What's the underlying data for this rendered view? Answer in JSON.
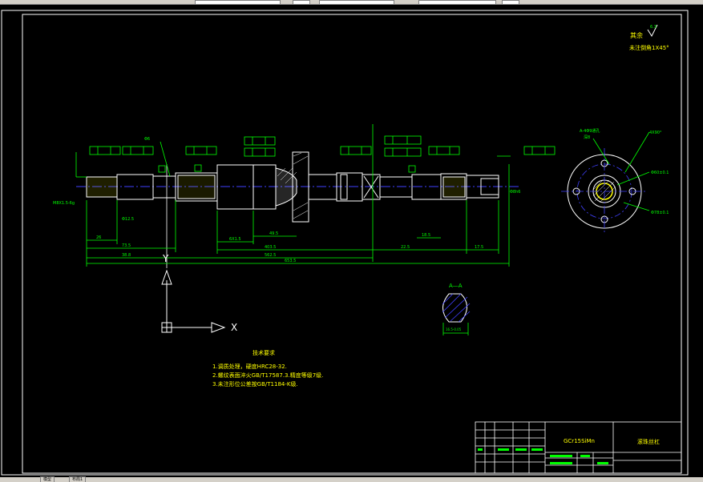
{
  "annotations": {
    "roughness_label": "其余",
    "chamfer_note": "未注倒角1X45°",
    "roughness_value": "6.3"
  },
  "dims": {
    "d_left_end": "Φ12.5",
    "d_tail": "Φ6",
    "d_right_bore": "Φ8h6",
    "bottom_1": "26",
    "bottom_2": "73.5",
    "bottom_3": "6X1.5",
    "bottom_4": "49.5",
    "bottom_5": "403.5",
    "bottom_6": "22.5",
    "bottom_7": "18.5",
    "bottom_8": "17.5",
    "overall_1": "38.8",
    "overall_2": "562.5",
    "overall_total": "653.5",
    "left_end_note": "M8X1.5-6g",
    "section_width": "16.5-0.05"
  },
  "section_a": {
    "title": "A—A"
  },
  "flange_view": {
    "label1": "A-4Φ9通孔",
    "label2": "深8",
    "label3": "4X90°",
    "label4": "Φ60±0.1",
    "label5": "Φ78±0.1"
  },
  "ucs": {
    "x": "X",
    "y": "Y"
  },
  "tech_req": {
    "title": "技术要求",
    "lines": [
      "1.调质处理，硬度HRC28-32.",
      "2.螺纹表面淬火GB/T17587.3.精度等级7级.",
      "3.未注形位公差按GB/T1184-K级."
    ]
  },
  "title_block": {
    "material": "GCr15SiMn",
    "part_name": "滚珠丝杠"
  },
  "tabs": [
    "模型",
    "布局1"
  ],
  "colors": {
    "background": "#000000",
    "lines": "#ffffff",
    "dims": "#00ff00",
    "centerline": "#0000ff",
    "accent": "#ffff00"
  }
}
